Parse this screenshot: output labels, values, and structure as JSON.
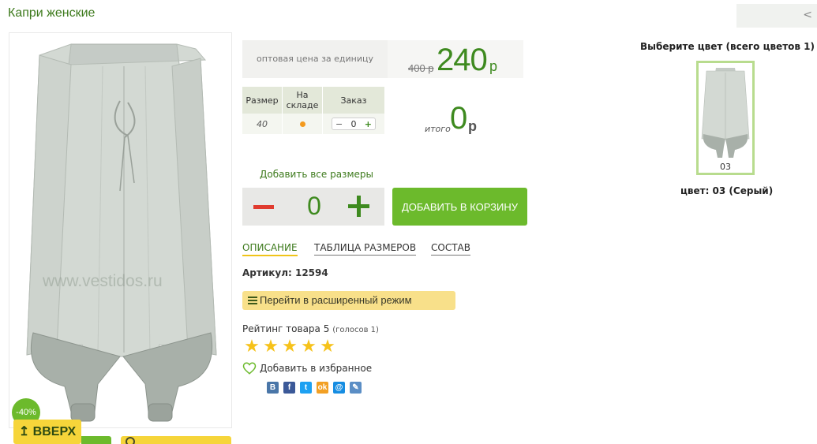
{
  "product": {
    "title": "Капри женские",
    "watermark": "www.vestidos.ru",
    "discount_badge": "-40%",
    "nav_prev": "<"
  },
  "back_to_top": "ВВЕРХ",
  "price": {
    "label": "оптовая цена за единицу",
    "old": "400 р",
    "current": "240",
    "currency": "р"
  },
  "size_table": {
    "headers": [
      "Размер",
      "На складе",
      "Заказ"
    ],
    "rows": [
      {
        "size": "40",
        "in_stock": true,
        "order_qty": "0",
        "minus": "−",
        "plus": "+"
      }
    ]
  },
  "total": {
    "label": "итого",
    "value": "0",
    "currency": "р"
  },
  "add_all_sizes": "Добавить все размеры",
  "quantity": {
    "value": "0"
  },
  "add_to_cart": "ДОБАВИТЬ В КОРЗИНУ",
  "tabs": [
    {
      "label": "ОПИСАНИЕ",
      "active": true
    },
    {
      "label": "ТАБЛИЦА РАЗМЕРОВ",
      "active": false
    },
    {
      "label": "СОСТАВ",
      "active": false
    }
  ],
  "sku": "Артикул: 12594",
  "extended_mode": "Перейти в расширенный режим",
  "rating": {
    "label": "Рейтинг товара 5",
    "votes": "(голосов 1)",
    "stars": 5
  },
  "favorite": "Добавить в избранное",
  "social": [
    {
      "icon": "vkontakte-icon",
      "glyph": "B",
      "color": "#4a76a8"
    },
    {
      "icon": "facebook-icon",
      "glyph": "f",
      "color": "#3b5998"
    },
    {
      "icon": "twitter-icon",
      "glyph": "t",
      "color": "#1da1f2"
    },
    {
      "icon": "odnoklassniki-icon",
      "glyph": "ok",
      "color": "#f2a024"
    },
    {
      "icon": "mailru-icon",
      "glyph": "@",
      "color": "#168de2"
    },
    {
      "icon": "livejournal-icon",
      "glyph": "✎",
      "color": "#5b8ec5"
    }
  ],
  "colors": {
    "title": "Выберите цвет (всего цветов 1)",
    "swatches": [
      {
        "code": "03"
      }
    ],
    "selected": "цвет: 03 (Серый)"
  },
  "theme": {
    "accent_green": "#6cba2c",
    "text_green": "#3e8a1f",
    "button_yellow": "#f6d53a",
    "minus_red": "#e03b2f",
    "star_yellow": "#f6c21a",
    "stock_orange": "#f39a1e"
  }
}
